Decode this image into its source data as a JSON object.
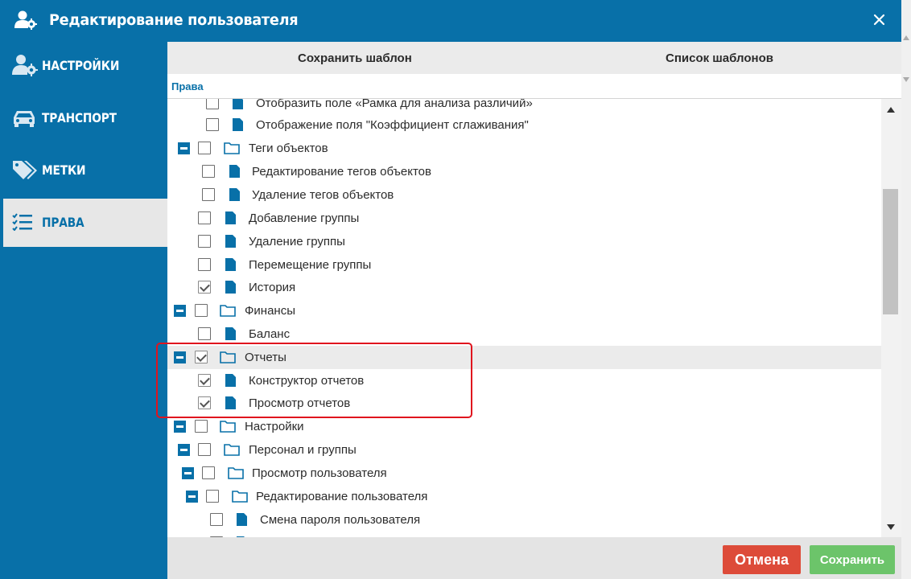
{
  "window": {
    "title": "Редактирование пользователя"
  },
  "sidebar": {
    "items": [
      {
        "label": "НАСТРОЙКИ"
      },
      {
        "label": "ТРАНСПОРТ"
      },
      {
        "label": "МЕТКИ"
      },
      {
        "label": "ПРАВА"
      }
    ]
  },
  "toolbar": {
    "save_template": "Сохранить шаблон",
    "template_list": "Список шаблонов"
  },
  "section": {
    "label": "Права"
  },
  "tree": {
    "rows": [
      {
        "label": "Отобразить поле «Рамка для анализа различий»",
        "type": "item",
        "checked": false
      },
      {
        "label": "Отображение поля \"Коэффициент сглаживания\"",
        "type": "item",
        "checked": false
      },
      {
        "label": "Теги объектов",
        "type": "folder",
        "checked": false
      },
      {
        "label": "Редактирование тегов объектов",
        "type": "item",
        "checked": false
      },
      {
        "label": "Удаление тегов объектов",
        "type": "item",
        "checked": false
      },
      {
        "label": "Добавление группы",
        "type": "item",
        "checked": false
      },
      {
        "label": "Удаление группы",
        "type": "item",
        "checked": false
      },
      {
        "label": "Перемещение группы",
        "type": "item",
        "checked": false
      },
      {
        "label": "История",
        "type": "item",
        "checked": true
      },
      {
        "label": "Финансы",
        "type": "folder",
        "checked": false
      },
      {
        "label": "Баланс",
        "type": "item",
        "checked": false
      },
      {
        "label": "Отчеты",
        "type": "folder",
        "checked": true
      },
      {
        "label": "Конструктор отчетов",
        "type": "item",
        "checked": true
      },
      {
        "label": "Просмотр отчетов",
        "type": "item",
        "checked": true
      },
      {
        "label": "Настройки",
        "type": "folder",
        "checked": false
      },
      {
        "label": "Персонал и группы",
        "type": "folder",
        "checked": false
      },
      {
        "label": "Просмотр пользователя",
        "type": "folder",
        "checked": false
      },
      {
        "label": "Редактирование пользователя",
        "type": "folder",
        "checked": false
      },
      {
        "label": "Смена пароля пользователя",
        "type": "item",
        "checked": false
      },
      {
        "label": "",
        "type": "item",
        "checked": false
      }
    ]
  },
  "footer": {
    "cancel": "Отмена",
    "save": "Сохранить"
  },
  "colors": {
    "primary": "#0870a8",
    "cancel": "#dd4b39",
    "save": "#6cc46a",
    "highlight_box": "#e0141e"
  }
}
